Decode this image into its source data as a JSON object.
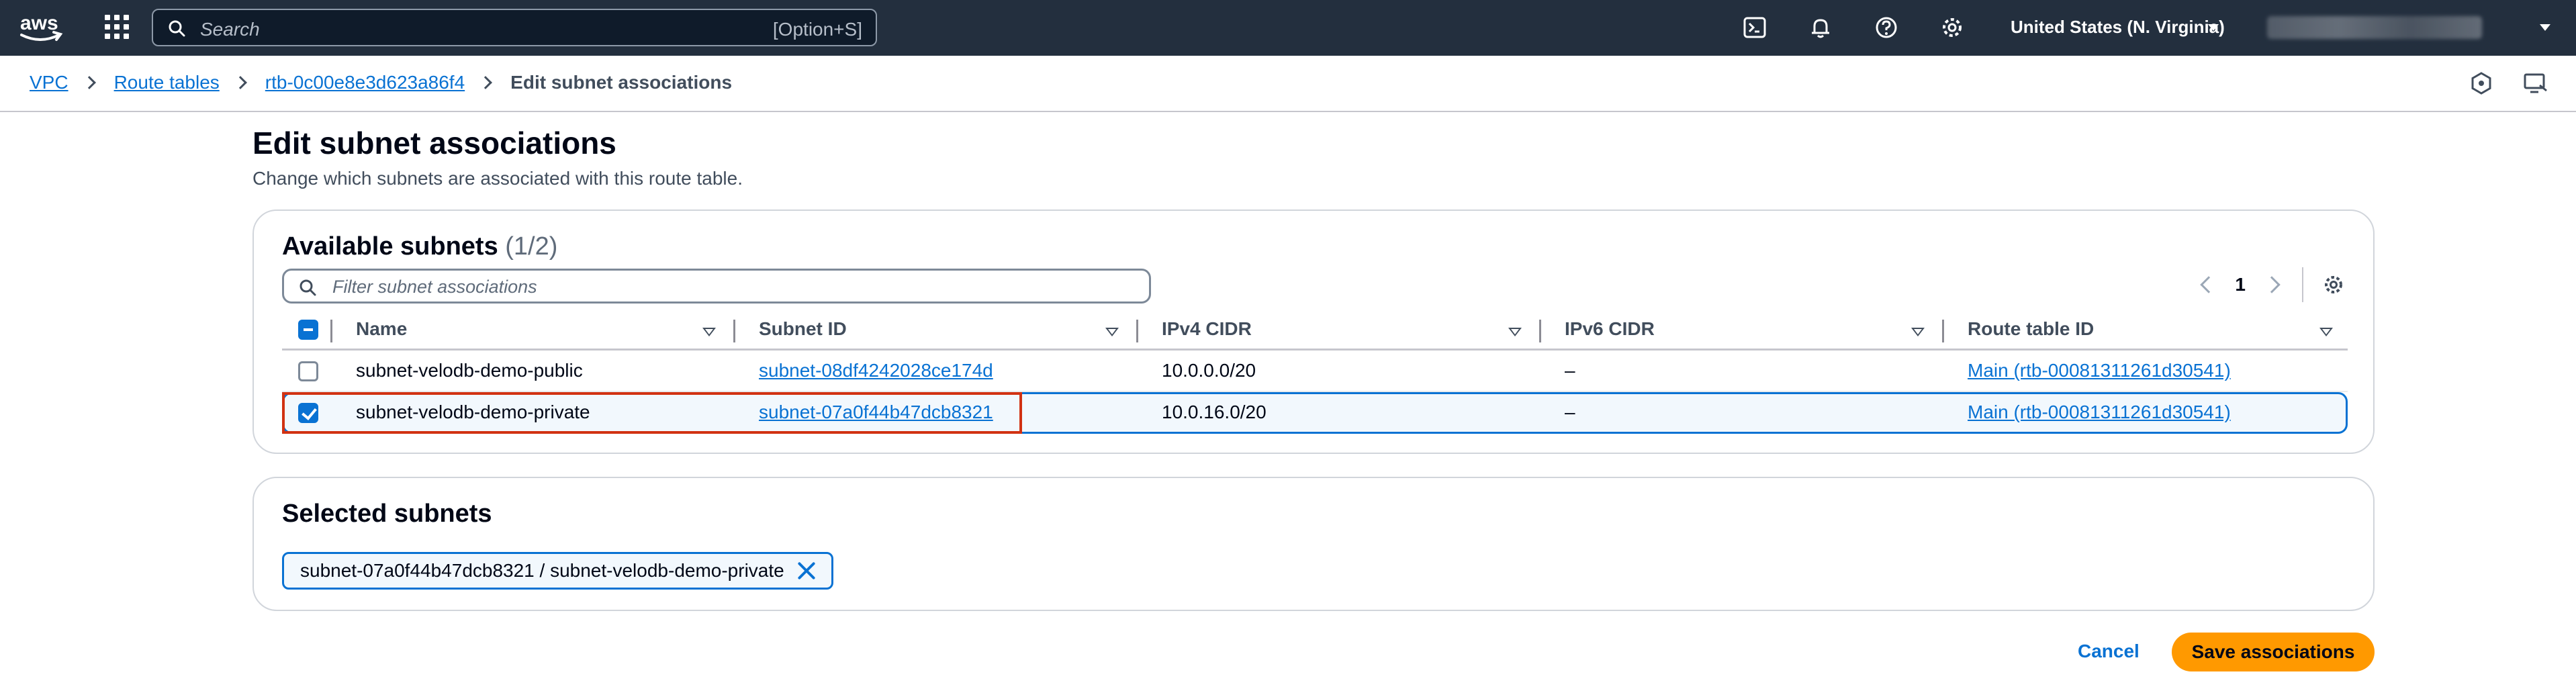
{
  "topnav": {
    "brand": "aws",
    "search_placeholder": "Search",
    "search_shortcut": "[Option+S]",
    "region": "United States (N. Virginia)"
  },
  "breadcrumb": {
    "items": [
      "VPC",
      "Route tables",
      "rtb-0c00e8e3d623a86f4"
    ],
    "current": "Edit subnet associations"
  },
  "page": {
    "title": "Edit subnet associations",
    "description": "Change which subnets are associated with this route table."
  },
  "available_subnets": {
    "title": "Available subnets",
    "count": "(1/2)",
    "filter_placeholder": "Filter subnet associations",
    "page_number": "1",
    "columns": [
      "Name",
      "Subnet ID",
      "IPv4 CIDR",
      "IPv6 CIDR",
      "Route table ID"
    ],
    "rows": [
      {
        "name": "subnet-velodb-demo-public",
        "subnet_id": "subnet-08df4242028ce174d",
        "ipv4": "10.0.0.0/20",
        "ipv6": "–",
        "route_table": "Main (rtb-00081311261d30541)",
        "checked": false
      },
      {
        "name": "subnet-velodb-demo-private",
        "subnet_id": "subnet-07a0f44b47dcb8321",
        "ipv4": "10.0.16.0/20",
        "ipv6": "–",
        "route_table": "Main (rtb-00081311261d30541)",
        "checked": true
      }
    ]
  },
  "selected_subnets": {
    "title": "Selected subnets",
    "tokens": [
      "subnet-07a0f44b47dcb8321 / subnet-velodb-demo-private"
    ]
  },
  "actions": {
    "cancel": "Cancel",
    "save": "Save associations"
  },
  "colors": {
    "nav_bg": "#232f3e",
    "link": "#0972d3",
    "primary_button": "#ff9900",
    "highlight": "#d13212"
  }
}
